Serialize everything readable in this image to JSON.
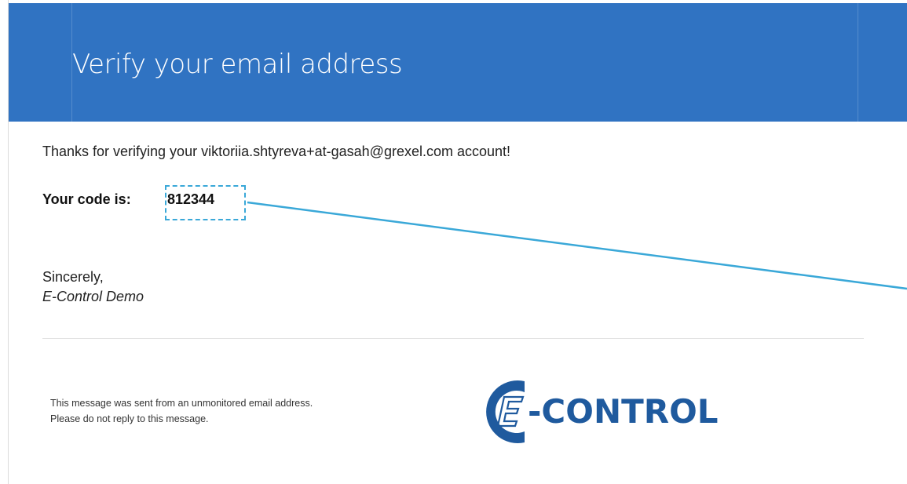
{
  "colors": {
    "banner": "#3073c2",
    "annotation": "#3aa8d8",
    "logo_blue": "#1f5a9e"
  },
  "email": {
    "heading": "Verify your email address",
    "thanks_text": "Thanks for verifying your viktoriia.shtyreva+at-gasah@grexel.com account!",
    "code_label": "Your code is:",
    "code_value": "812344",
    "closing": "Sincerely,",
    "signature": "E-Control Demo"
  },
  "footer": {
    "note_line_1": "This message was sent from an unmonitored email address.",
    "note_line_2": "Please do not reply to this message.",
    "logo_text": "-CONTROL",
    "logo_letter": "E"
  },
  "annotation": {
    "type": "dashed-highlight-with-pointer"
  }
}
